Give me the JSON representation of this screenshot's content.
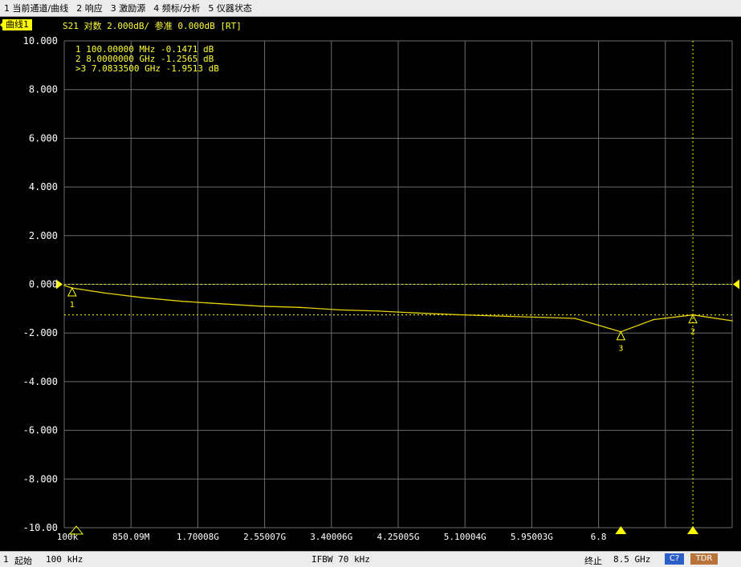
{
  "menu": {
    "items": [
      "1 当前通道/曲线",
      "2 响应",
      "3 激励源",
      "4 频标/分析",
      "5 仪器状态"
    ]
  },
  "trace": {
    "channel_tag": "曲线1",
    "param": "S21",
    "scale_label": "对数",
    "scale_value": "2.000dB/",
    "ref_label": "参准",
    "ref_value": "0.000dB",
    "rt": "[RT]"
  },
  "markers": [
    {
      "id": "1",
      "value": "100.00000",
      "unit": "MHz",
      "reading": "-0.1471",
      "runit": "dB",
      "active": false
    },
    {
      "id": "2",
      "value": "8.0000000",
      "unit": "GHz",
      "reading": "-1.2565",
      "runit": "dB",
      "active": false
    },
    {
      "id": "3",
      "value": "7.0833500",
      "unit": "GHz",
      "reading": "-1.9513",
      "runit": "dB",
      "active": true
    }
  ],
  "colors": {
    "trace": "#e6d200",
    "text": "#ffff33",
    "grid": "#6e6e6e",
    "marker": "#ffff00"
  },
  "axes": {
    "y_ticks": [
      "10.000",
      "8.000",
      "6.000",
      "4.000",
      "2.000",
      "0.000",
      "-2.000",
      "-4.000",
      "-6.000",
      "-8.000",
      "-10.00"
    ],
    "x_ticks": [
      "100k",
      "850.09M",
      "1.70008G",
      "2.55007G",
      "3.40006G",
      "4.25005G",
      "5.10004G",
      "5.95003G",
      "6.8"
    ],
    "ylim": [
      -10,
      10
    ],
    "x_range_hz": [
      100000,
      8500000000
    ],
    "ref_level_db": 0.0,
    "ref_line_db": -1.2565
  },
  "chart_data": {
    "type": "line",
    "xlabel": "",
    "ylabel": "",
    "ylim": [
      -10,
      10
    ],
    "xlim": [
      100000,
      8500000000
    ],
    "grid": true,
    "series": [
      {
        "x": [
          100000,
          100000000,
          500000000,
          1000000000,
          1500000000,
          2000000000,
          2500000000,
          3000000000,
          3500000000,
          4000000000,
          4500000000,
          5000000000,
          5500000000,
          6000000000,
          6500000000,
          7083350000,
          7500000000,
          8000000000,
          8500000000
        ],
        "values": [
          -0.05,
          -0.15,
          -0.35,
          -0.55,
          -0.7,
          -0.8,
          -0.9,
          -0.95,
          -1.05,
          -1.1,
          -1.18,
          -1.25,
          -1.3,
          -1.35,
          -1.4,
          -1.95,
          -1.45,
          -1.26,
          -1.5
        ]
      }
    ]
  },
  "status": {
    "index": "1",
    "start_label": "起始",
    "start_value": "100 kHz",
    "ifbw": "IFBW 70 kHz",
    "stop_label": "终止",
    "stop_value": "8.5 GHz",
    "btn_c": "C?",
    "btn_tdr": "TDR"
  }
}
